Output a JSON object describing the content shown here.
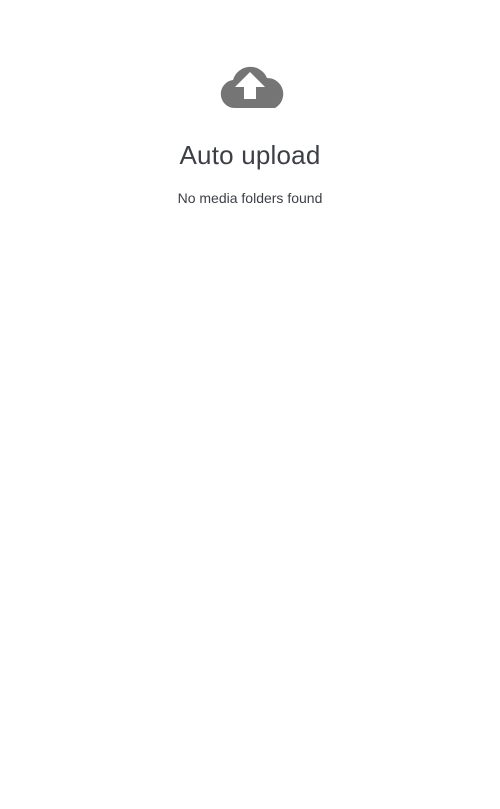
{
  "empty_state": {
    "icon": "cloud-upload-icon",
    "title": "Auto upload",
    "message": "No media folders found"
  },
  "colors": {
    "icon": "#757575",
    "text": "#3c3f46",
    "background": "#ffffff"
  }
}
